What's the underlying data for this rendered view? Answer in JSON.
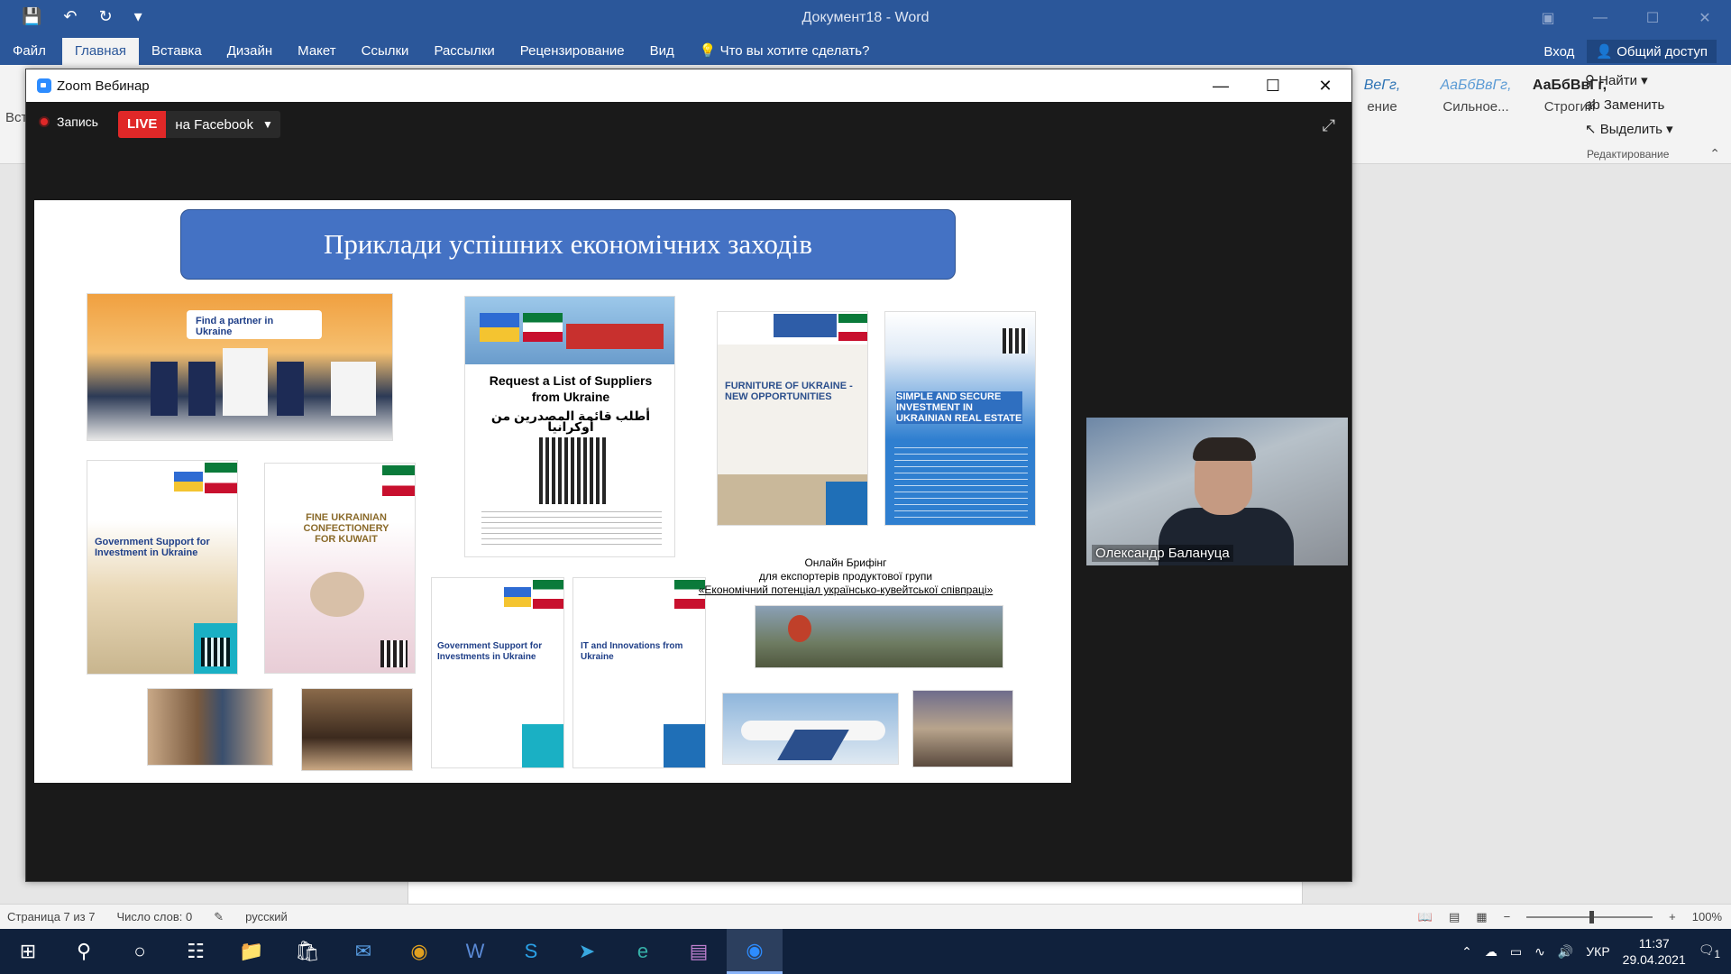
{
  "word": {
    "doc_title": "Документ18 - Word",
    "tabs": [
      "Файл",
      "Главная",
      "Вставка",
      "Дизайн",
      "Макет",
      "Ссылки",
      "Рассылки",
      "Рецензирование",
      "Вид"
    ],
    "active_tab": "Главная",
    "tell_me": "Что вы хотите сделать?",
    "login": "Вход",
    "share": "Общий доступ",
    "styles": [
      {
        "preview": "ВеГг,",
        "name": "ение"
      },
      {
        "preview": "АаБбВвГг,",
        "name": "Сильное..."
      },
      {
        "preview": "АаБбВвГг,",
        "name": "Строгий"
      }
    ],
    "edit": {
      "find": "Найти",
      "replace": "Заменить",
      "select": "Выделить",
      "group_label": "Редактирование"
    },
    "left_stub": "Вст",
    "status": {
      "page": "Страница 7 из 7",
      "words": "Число слов: 0",
      "lang": "русский",
      "zoom": "100%"
    }
  },
  "zoom": {
    "window_title": "Zoom Вебинар",
    "recording": "Запись",
    "live_badge": "LIVE",
    "live_target": "на Facebook",
    "speaker_name": "Олександр Балануца",
    "slide": {
      "title": "Приклади успішних економічних заходів",
      "thumbs": {
        "t1": "Find a partner in Ukraine",
        "t2_en": "Request a List of Suppliers from Ukraine",
        "t2_ar": "أطلب قائمة المصدرين من أوكرانيا",
        "t3": "FURNITURE OF UKRAINE - NEW OPPORTUNITIES",
        "t4": "SIMPLE AND SECURE INVESTMENT IN UKRAINIAN REAL ESTATE",
        "t5": "Government Support for Investment in Ukraine",
        "t6": "FINE UKRAINIAN CONFECTIONERY FOR KUWAIT",
        "t7": "Government Support for Investments in Ukraine",
        "t8": "IT and Innovations from Ukraine"
      },
      "brief": {
        "line1": "Онлайн Брифінг",
        "line2": "для експортерів продуктової групи",
        "line3": "«Економічний потенціал українсько-кувейтської співпраці»"
      }
    }
  },
  "taskbar": {
    "lang": "УКР",
    "time": "11:37",
    "date": "29.04.2021",
    "notif": "1"
  }
}
